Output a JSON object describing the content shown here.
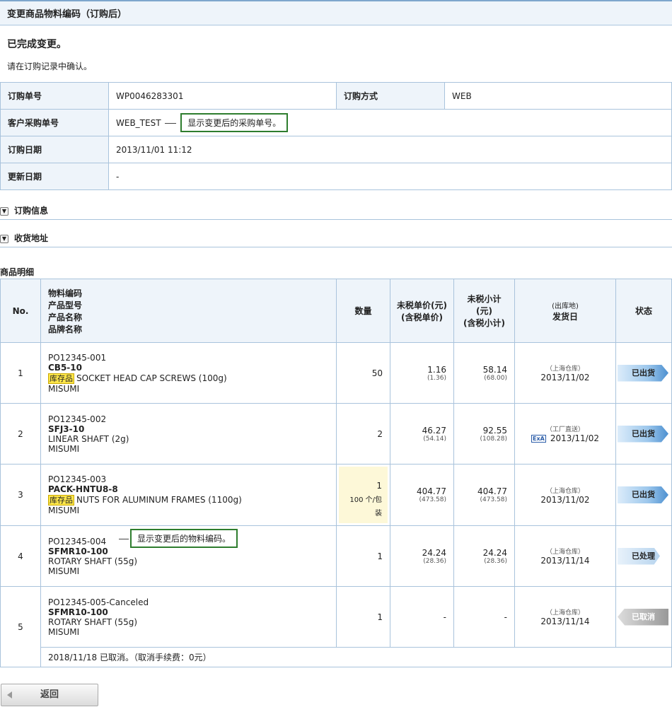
{
  "title": "变更商品物料编码（订购后）",
  "done_message": "已完成变更。",
  "confirm_message": "请在订购记录中确认。",
  "info": {
    "order_no_label": "订购单号",
    "order_no_value": "WP0046283301",
    "order_method_label": "订购方式",
    "order_method_value": "WEB",
    "customer_po_label": "客户采购单号",
    "customer_po_value": "WEB_TEST",
    "customer_po_callout": "显示变更后的采购单号。",
    "order_date_label": "订购日期",
    "order_date_value": "2013/11/01 11:12",
    "update_date_label": "更新日期",
    "update_date_value": "-"
  },
  "sections": {
    "order_info": "订购信息",
    "delivery_address": "收货地址"
  },
  "goods": {
    "title": "商品明细",
    "headers": {
      "no": "No.",
      "item_lines": [
        "物料编码",
        "产品型号",
        "产品名称",
        "品牌名称"
      ],
      "qty": "数量",
      "unit_price": "未税单价(元)",
      "unit_price_tax": "(含税单价)",
      "subtotal_1": "未税小计",
      "subtotal_2": "(元)",
      "subtotal_tax": "(含税小计)",
      "ship_origin": "(出库地)",
      "ship_date": "发货日",
      "status": "状态"
    },
    "rows": [
      {
        "no": "1",
        "material": "PO12345-001",
        "model": "CB5-10",
        "stock": "库存品",
        "name": "SOCKET HEAD CAP SCREWS (100g)",
        "brand": "MISUMI",
        "qty": "50",
        "unit": "1.16",
        "unit_tax": "(1.36)",
        "subtotal": "58.14",
        "subtotal_tax": "(68.00)",
        "origin": "（上海仓库）",
        "date": "2013/11/02",
        "status": "已出货"
      },
      {
        "no": "2",
        "material": "PO12345-002",
        "model": "SFJ3-10",
        "stock": "",
        "name": "LINEAR SHAFT (2g)",
        "brand": "MISUMI",
        "qty": "2",
        "unit": "46.27",
        "unit_tax": "(54.14)",
        "subtotal": "92.55",
        "subtotal_tax": "(108.28)",
        "origin": "（工厂直送）",
        "date": "2013/11/02",
        "exa": "ExA",
        "status": "已出货"
      },
      {
        "no": "3",
        "material": "PO12345-003",
        "model": "PACK-HNTU8-8",
        "stock": "库存品",
        "name": "NUTS FOR ALUMINUM FRAMES (1100g)",
        "brand": "MISUMI",
        "qty": "1",
        "qty_pack": "100 个/包",
        "qty_pack2": "装",
        "unit": "404.77",
        "unit_tax": "(473.58)",
        "subtotal": "404.77",
        "subtotal_tax": "(473.58)",
        "origin": "（上海仓库）",
        "date": "2013/11/02",
        "status": "已出货"
      },
      {
        "no": "4",
        "material": "PO12345-004",
        "model": "SFMR10-100",
        "stock": "",
        "name": "ROTARY SHAFT (55g)",
        "brand": "MISUMI",
        "qty": "1",
        "unit": "24.24",
        "unit_tax": "(28.36)",
        "subtotal": "24.24",
        "subtotal_tax": "(28.36)",
        "origin": "（上海仓库）",
        "date": "2013/11/14",
        "status": "已处理",
        "callout": "显示变更后的物料编码。"
      },
      {
        "no": "5",
        "material": "PO12345-005-Canceled",
        "model": "SFMR10-100",
        "stock": "",
        "name": "ROTARY SHAFT (55g)",
        "brand": "MISUMI",
        "qty": "1",
        "unit": "-",
        "unit_tax": "",
        "subtotal": "-",
        "subtotal_tax": "",
        "origin": "（上海仓库）",
        "date": "2013/11/14",
        "status": "已取消",
        "cancel_note": "2018/11/18 已取消。（取消手续费：0元）"
      }
    ]
  },
  "back_label": "返回",
  "colors": {
    "accent": "#7ea6cc",
    "header_bg": "#eef4fa",
    "border": "#a9c3dc",
    "callout_border": "#2e7d2e",
    "stock_badge": "#ffe74a"
  }
}
